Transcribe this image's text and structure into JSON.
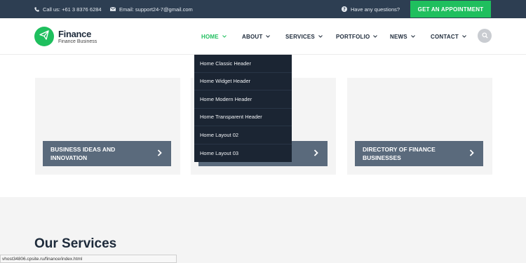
{
  "topbar": {
    "phone": "Call us: +61 3 8376 6284",
    "email": "Email: support24-7@gmail.com",
    "question": "Have any questions?",
    "appointment_label": "GET AN APPOINTMENT"
  },
  "header": {
    "brand": "Finance",
    "tagline": "Finance Business",
    "nav": [
      {
        "label": "HOME",
        "active": true
      },
      {
        "label": "ABOUT"
      },
      {
        "label": "SERVICES"
      },
      {
        "label": "PORTFOLIO"
      },
      {
        "label": "NEWS"
      },
      {
        "label": "CONTACT"
      }
    ]
  },
  "dropdown": {
    "items": [
      "Home Classic Header",
      "Home Widget Header",
      "Home Modern Header",
      "Home Transparent Header",
      "Home Layout 02",
      "Home Layout 03"
    ]
  },
  "cards": [
    {
      "title_line1": "BUSINESS IDEAS AND",
      "title_line2": "INNOVATION"
    },
    {
      "title_line1": "",
      "title_line2": ""
    },
    {
      "title_line1": "DIRECTORY OF FINANCE",
      "title_line2": "BUSINESSES"
    }
  ],
  "services": {
    "title": "Our Services"
  },
  "statusbar": {
    "url": "vhost34806.cpsite.ru/finance/index.html"
  },
  "colors": {
    "accent": "#1fbf5e",
    "topbar": "#2d3e52",
    "card_bar": "#5a6a7c",
    "dropdown": "#1b2533"
  },
  "icons": {
    "phone": "phone-icon",
    "email": "envelope-icon",
    "question": "question-circle-icon",
    "logo": "paper-plane-icon",
    "search": "search-icon"
  }
}
